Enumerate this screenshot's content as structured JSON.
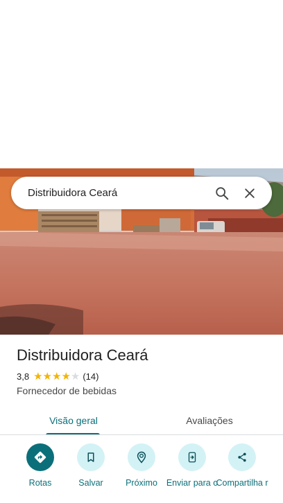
{
  "search": {
    "query": "Distribuidora Ceará",
    "search_icon": "search-icon",
    "close_icon": "close-icon"
  },
  "place": {
    "name": "Distribuidora Ceará",
    "rating": "3,8",
    "rating_value": 3.8,
    "stars_filled": 4,
    "stars_total": 5,
    "review_count": "(14)",
    "category": "Fornecedor de bebidas"
  },
  "tabs": [
    {
      "label": "Visão geral",
      "selected": true
    },
    {
      "label": "Avaliações",
      "selected": false
    }
  ],
  "actions": [
    {
      "label": "Rotas",
      "icon": "directions-icon"
    },
    {
      "label": "Salvar",
      "icon": "bookmark-icon"
    },
    {
      "label": "Próximo",
      "icon": "nearby-icon"
    },
    {
      "label": "Enviar para o",
      "icon": "send-to-phone-icon"
    },
    {
      "label": "Compartilha r",
      "icon": "share-icon"
    }
  ],
  "colors": {
    "accent": "#0b6f7a",
    "action_bg": "#d3f2f6",
    "star": "#f4b400"
  }
}
